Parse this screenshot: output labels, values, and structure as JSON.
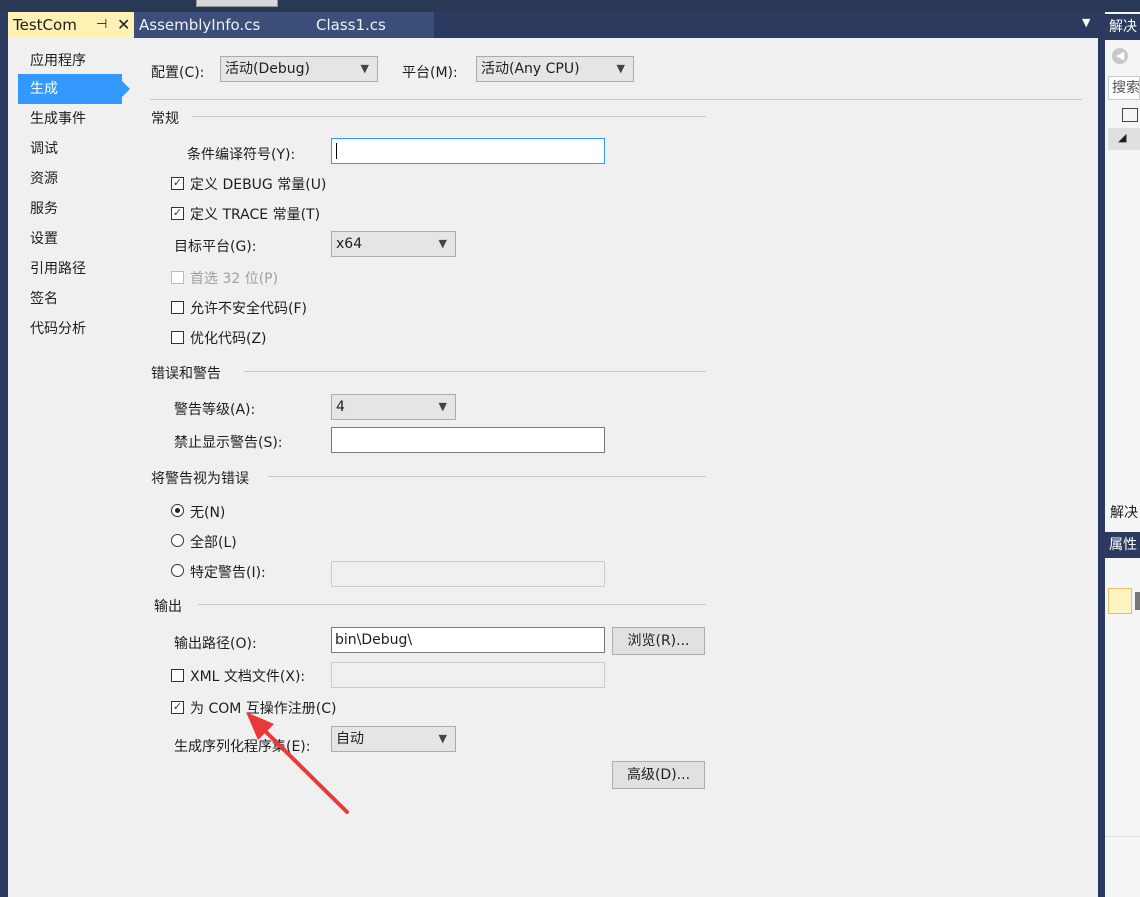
{
  "tabs": {
    "active": "TestCom",
    "pin_glyph": "⊣",
    "close_glyph": "✕",
    "others": [
      "AssemblyInfo.cs",
      "Class1.cs"
    ],
    "dropdown_glyph": "▼"
  },
  "nav": {
    "items": [
      "应用程序",
      "生成",
      "生成事件",
      "调试",
      "资源",
      "服务",
      "设置",
      "引用路径",
      "签名",
      "代码分析"
    ],
    "active_index": 1
  },
  "toolbar": {
    "config_label": "配置(C):",
    "config_value": "活动(Debug)",
    "platform_label": "平台(M):",
    "platform_value": "活动(Any CPU)"
  },
  "general": {
    "header": "常规",
    "cond_symbols_label": "条件编译符号(Y):",
    "cond_symbols_value": "",
    "define_debug_label": "定义 DEBUG 常量(U)",
    "define_debug_checked": true,
    "define_trace_label": "定义 TRACE 常量(T)",
    "define_trace_checked": true,
    "target_platform_label": "目标平台(G):",
    "target_platform_value": "x64",
    "prefer32_label": "首选 32 位(P)",
    "prefer32_checked": false,
    "unsafe_label": "允许不安全代码(F)",
    "unsafe_checked": false,
    "optimize_label": "优化代码(Z)",
    "optimize_checked": false
  },
  "errors": {
    "header": "错误和警告",
    "warning_level_label": "警告等级(A):",
    "warning_level_value": "4",
    "suppress_label": "禁止显示警告(S):",
    "suppress_value": ""
  },
  "treat_warnings": {
    "header": "将警告视为错误",
    "none_label": "无(N)",
    "all_label": "全部(L)",
    "specific_label": "特定警告(I):",
    "selected": "none"
  },
  "output": {
    "header": "输出",
    "path_label": "输出路径(O):",
    "path_value": "bin\\Debug\\",
    "browse_button": "浏览(R)...",
    "xml_doc_label": "XML 文档文件(X):",
    "xml_doc_checked": false,
    "com_register_label": "为 COM 互操作注册(C)",
    "com_register_checked": true,
    "serialization_label": "生成序列化程序集(E):",
    "serialization_value": "自动",
    "advanced_button": "高级(D)..."
  },
  "right_panel": {
    "solution_header": "解决",
    "search_placeholder": "搜索",
    "solution_footer": "解决",
    "properties_header": "属性"
  },
  "colors": {
    "accent": "#3399ff",
    "active_tab": "#fff0b3",
    "annotation_arrow": "#e8393b"
  }
}
